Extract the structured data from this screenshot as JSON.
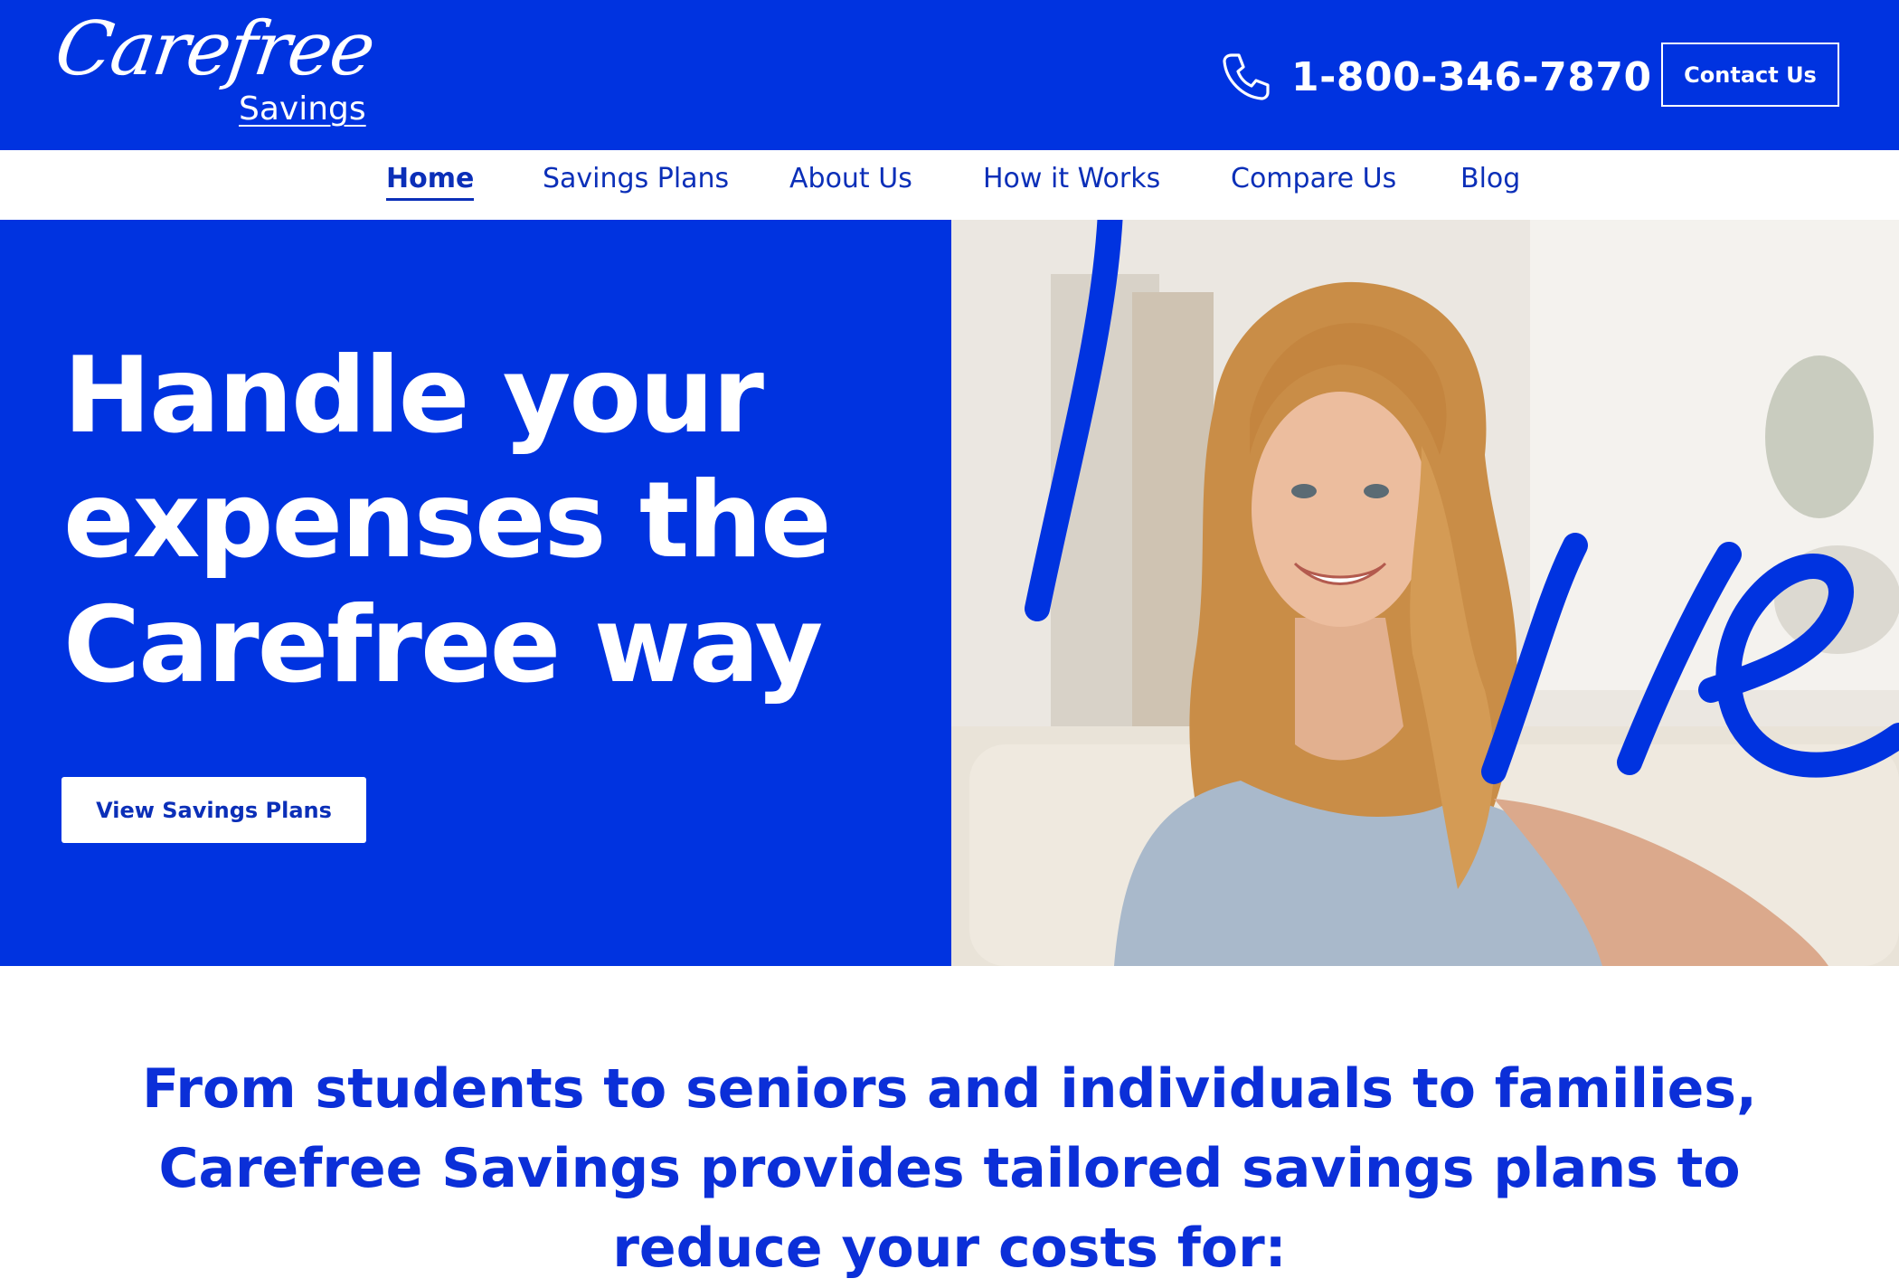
{
  "header": {
    "logo_script": "Carefree",
    "logo_sub": "Savings",
    "phone_icon": "phone-icon",
    "phone": "1-800-346-7870",
    "contact_label": "Contact Us"
  },
  "nav": {
    "items": [
      {
        "label": "Home",
        "active": true
      },
      {
        "label": "Savings Plans"
      },
      {
        "label": "About Us"
      },
      {
        "label": "How it Works"
      },
      {
        "label": "Compare Us"
      },
      {
        "label": "Blog"
      }
    ]
  },
  "hero": {
    "title": "Handle your expenses the Carefree way",
    "button_label": "View Savings Plans",
    "image_alt": "smiling woman with long wavy hair seated on sofa",
    "colors": {
      "brand": "#0033e0",
      "text": "#ffffff"
    }
  },
  "intro": {
    "text": "From students to seniors and individuals to families, Carefree Savings provides tailored savings plans to reduce your costs for:"
  }
}
